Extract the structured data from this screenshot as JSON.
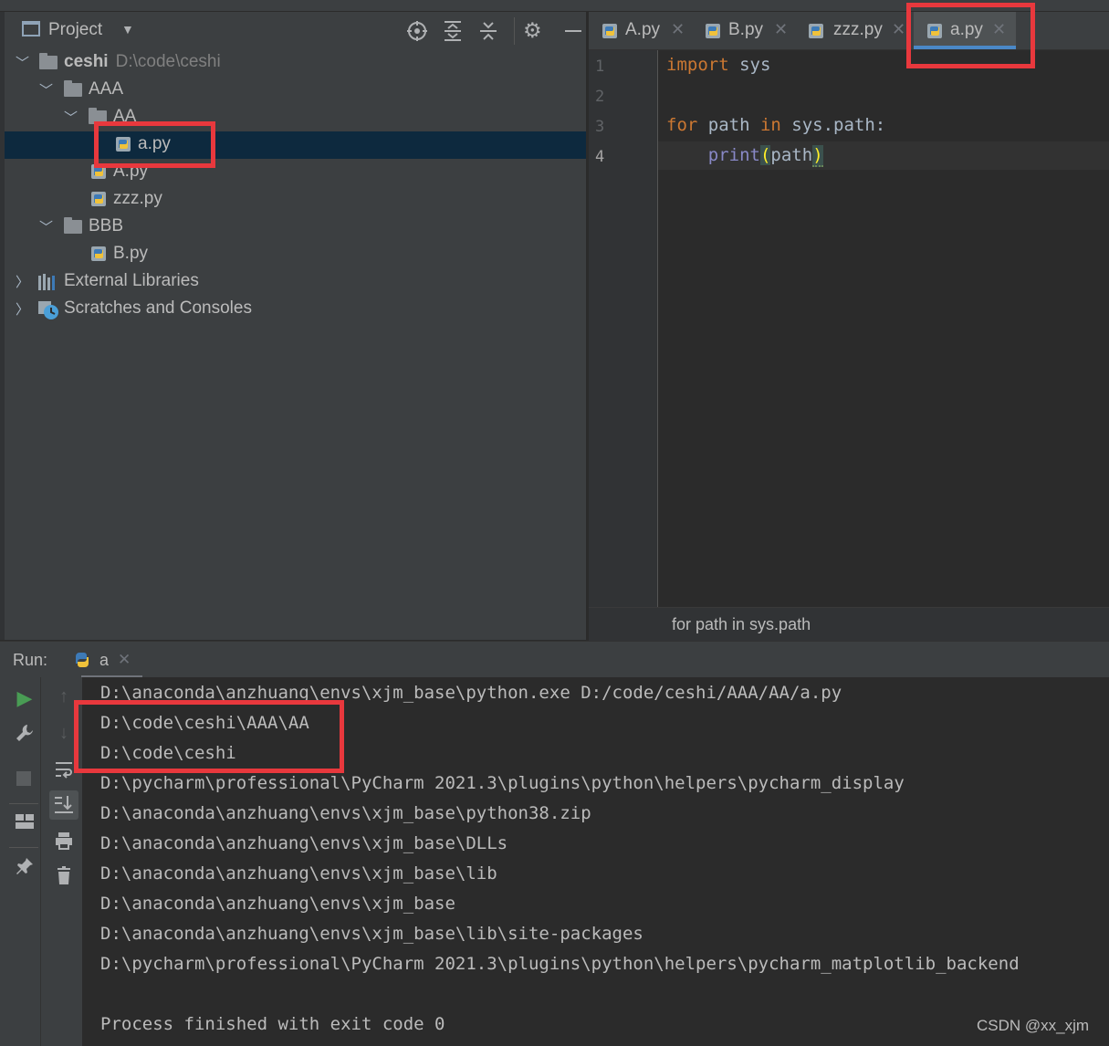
{
  "project_panel": {
    "title": "Project",
    "tree": [
      {
        "name": "ceshi",
        "path": "D:\\code\\ceshi"
      },
      {
        "name": "AAA"
      },
      {
        "name": "AA"
      },
      {
        "name": "a.py"
      },
      {
        "name": "A.py"
      },
      {
        "name": "zzz.py"
      },
      {
        "name": "BBB"
      },
      {
        "name": "B.py"
      },
      {
        "name": "External Libraries"
      },
      {
        "name": "Scratches and Consoles"
      }
    ]
  },
  "editor": {
    "tabs": [
      "A.py",
      "B.py",
      "zzz.py",
      "a.py"
    ],
    "active_tab": "a.py",
    "line_numbers": [
      "1",
      "2",
      "3",
      "4"
    ],
    "code": {
      "l1_kw": "import",
      "l1_rest": " sys",
      "l3_kw1": "for",
      "l3_mid": " path ",
      "l3_kw2": "in",
      "l3_rest": " sys.path:",
      "l4_indent": "    ",
      "l4_fn": "print",
      "l4_open": "(",
      "l4_arg": "path",
      "l4_close": ")"
    },
    "breadcrumb": "for path in sys.path"
  },
  "run": {
    "label": "Run:",
    "tab_name": "a",
    "output": [
      "D:\\anaconda\\anzhuang\\envs\\xjm_base\\python.exe D:/code/ceshi/AAA/AA/a.py",
      "D:\\code\\ceshi\\AAA\\AA",
      "D:\\code\\ceshi",
      "D:\\pycharm\\professional\\PyCharm 2021.3\\plugins\\python\\helpers\\pycharm_display",
      "D:\\anaconda\\anzhuang\\envs\\xjm_base\\python38.zip",
      "D:\\anaconda\\anzhuang\\envs\\xjm_base\\DLLs",
      "D:\\anaconda\\anzhuang\\envs\\xjm_base\\lib",
      "D:\\anaconda\\anzhuang\\envs\\xjm_base",
      "D:\\anaconda\\anzhuang\\envs\\xjm_base\\lib\\site-packages",
      "D:\\pycharm\\professional\\PyCharm 2021.3\\plugins\\python\\helpers\\pycharm_matplotlib_backend",
      "",
      "Process finished with exit code 0"
    ]
  },
  "watermark": "CSDN @xx_xjm",
  "colors": {
    "highlight": "#e8383d",
    "keyword": "#cc7832",
    "builtin": "#8888c6",
    "bracket": "#ffef28",
    "selection": "#0d293e"
  }
}
